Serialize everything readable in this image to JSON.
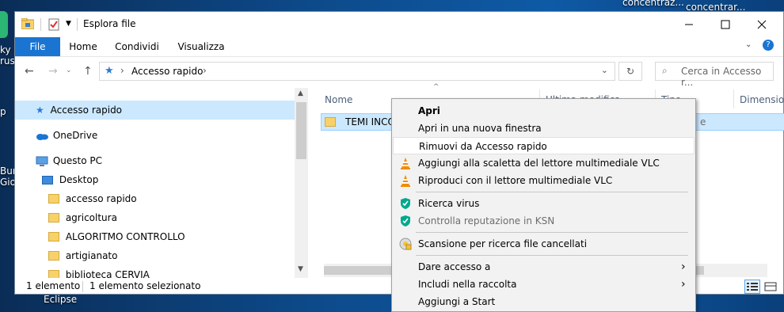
{
  "desktop": {
    "top_right_label_1": "concentraz...",
    "top_right_label_2": "concentrar...",
    "left_fragment_1": "ky",
    "left_fragment_2": "rus",
    "left_fragment_3": "p",
    "left_fragment_4": "Burr",
    "left_fragment_5": "Gioc",
    "bottom_label": "Eclipse"
  },
  "window": {
    "title": "Esplora file",
    "ribbon_tabs": [
      "File",
      "Home",
      "Condividi",
      "Visualizza"
    ],
    "address_path": "Accesso rapido",
    "search_placeholder": "Cerca in Accesso r..."
  },
  "nav_pane": {
    "items": [
      {
        "label": "Accesso rapido",
        "icon": "star-icon"
      },
      {
        "label": "OneDrive",
        "icon": "cloud-icon"
      },
      {
        "label": "Questo PC",
        "icon": "computer-icon"
      },
      {
        "label": "Desktop",
        "icon": "desktop-folder-icon"
      },
      {
        "label": "accesso rapido",
        "icon": "folder-icon"
      },
      {
        "label": "agricoltura",
        "icon": "folder-icon"
      },
      {
        "label": "ALGORITMO CONTROLLO",
        "icon": "folder-icon"
      },
      {
        "label": "artigianato",
        "icon": "folder-icon"
      },
      {
        "label": "biblioteca CERVIA",
        "icon": "folder-icon"
      }
    ]
  },
  "content": {
    "columns": [
      "Nome",
      "Ultima modifica",
      "Tipo",
      "Dimensione"
    ],
    "rows": [
      {
        "name": "TEMI INCON",
        "type_fragment": "e"
      }
    ]
  },
  "status": {
    "count": "1 elemento",
    "selected": "1 elemento selezionato"
  },
  "context_menu": {
    "items": [
      {
        "label": "Apri",
        "bold": true
      },
      {
        "label": "Apri in una nuova finestra"
      },
      {
        "label": "Rimuovi da Accesso rapido",
        "highlighted": true
      },
      {
        "label": "Aggiungi alla scaletta del lettore multimediale VLC",
        "icon": "vlc-cone-icon"
      },
      {
        "label": "Riproduci con il lettore multimediale VLC",
        "icon": "vlc-cone-icon"
      },
      {
        "label": "Ricerca virus",
        "icon": "kaspersky-shield-icon"
      },
      {
        "label": "Controlla reputazione in KSN",
        "icon": "kaspersky-shield-icon",
        "disabled": true
      },
      {
        "label": "Scansione per ricerca file cancellati",
        "icon": "recovery-icon"
      },
      {
        "label": "Dare accesso a",
        "submenu": true
      },
      {
        "label": "Includi nella raccolta",
        "submenu": true
      },
      {
        "label": "Aggiungi a Start"
      }
    ]
  },
  "colors": {
    "accent": "#1a74d2",
    "selection": "#cce8ff",
    "vlc_orange": "#f48b00",
    "kaspersky_green": "#00a88e"
  }
}
